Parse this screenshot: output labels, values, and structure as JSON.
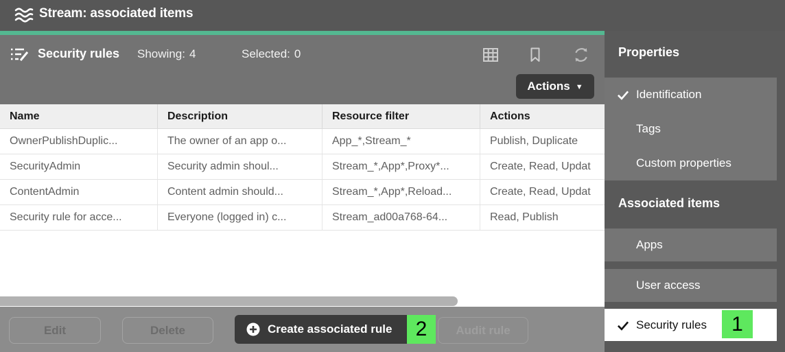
{
  "top_bar": {
    "title": "Stream: associated items"
  },
  "toolbar": {
    "title": "Security rules",
    "showing_label": "Showing:",
    "showing_value": "4",
    "selected_label": "Selected:",
    "selected_value": "0",
    "actions_button": "Actions",
    "caret": "▼"
  },
  "table": {
    "columns": [
      "Name",
      "Description",
      "Resource filter",
      "Actions"
    ],
    "rows": [
      [
        "OwnerPublishDuplic...",
        "The owner of an app o...",
        "App_*,Stream_*",
        "Publish, Duplicate"
      ],
      [
        "SecurityAdmin",
        "Security admin shoul...",
        "Stream_*,App*,Proxy*...",
        "Create, Read, Updat"
      ],
      [
        "ContentAdmin",
        "Content admin should...",
        "Stream_*,App*,Reload...",
        "Create, Read, Updat"
      ],
      [
        "Security rule for acce...",
        "Everyone (logged in) c...",
        "Stream_ad00a768-64...",
        "Read, Publish"
      ]
    ]
  },
  "sidebar": {
    "sections": [
      {
        "title": "Properties",
        "items": [
          {
            "label": "Identification",
            "checked": true
          },
          {
            "label": "Tags",
            "checked": false
          },
          {
            "label": "Custom properties",
            "checked": false
          }
        ]
      },
      {
        "title": "Associated items",
        "items": [
          {
            "label": "Apps",
            "checked": false
          },
          {
            "label": "User access",
            "checked": false
          },
          {
            "label": "Security rules",
            "checked": true,
            "selected": true,
            "badge": "1"
          }
        ]
      }
    ]
  },
  "bottom_bar": {
    "buttons": [
      {
        "label": "Edit",
        "disabled": true
      },
      {
        "label": "Delete",
        "disabled": true
      },
      {
        "label": "Create associated rule",
        "primary": true,
        "badge": "2"
      },
      {
        "label": "Audit rule",
        "disabled": true
      }
    ]
  },
  "icons": {
    "topbar_logo": "stream-icon",
    "toolbar_left": "list-edit-icon",
    "toolbar_right": [
      "column-selector-icon",
      "bookmark-icon",
      "refresh-icon"
    ],
    "primary_button": "plus-circle-icon",
    "checked_items": "checkmark-icon"
  },
  "colors": {
    "accent_teal": "#54B891",
    "annotation_badge_green": "#5EE85E",
    "topbar_bg": "#575757",
    "content_bg": "#737373",
    "sidebar_bg": "#595959",
    "sidebar_item_bg": "#757575",
    "bottom_bar_bg": "#8C8C8C",
    "primary_button_bg": "#3A3A3A"
  }
}
